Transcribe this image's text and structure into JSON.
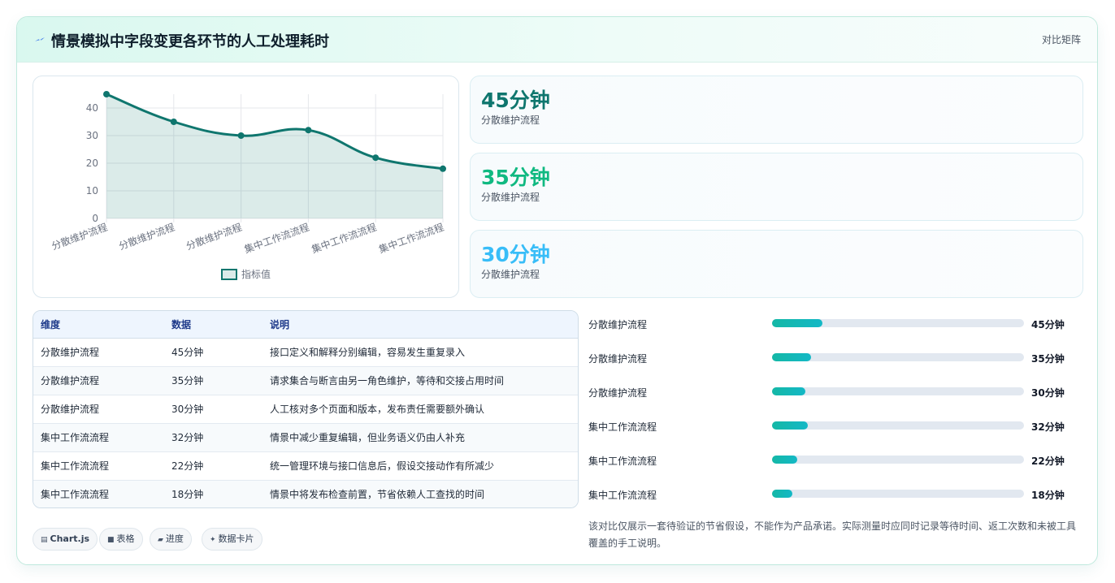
{
  "header": {
    "title": "情景模拟中字段变更各环节的人工处理耗时",
    "compare_label": "对比矩阵"
  },
  "colors": {
    "line": "#0f766e",
    "stat1": "#0f766e",
    "stat2": "#10b981",
    "stat3": "#38bdf8"
  },
  "chart_data": {
    "type": "line",
    "categories": [
      "分散维护流程",
      "分散维护流程",
      "分散维护流程",
      "集中工作流流程",
      "集中工作流流程",
      "集中工作流流程"
    ],
    "series": [
      {
        "name": "指标值",
        "values": [
          45,
          35,
          30,
          32,
          22,
          18
        ]
      }
    ],
    "yticks": [
      "0",
      "10",
      "20",
      "30",
      "40"
    ],
    "ylim": [
      0,
      45
    ],
    "fill": true,
    "grid": true,
    "legend_position": "bottom"
  },
  "stats": [
    {
      "value": "45分钟",
      "label": "分散维护流程"
    },
    {
      "value": "35分钟",
      "label": "分散维护流程"
    },
    {
      "value": "30分钟",
      "label": "分散维护流程"
    }
  ],
  "table": {
    "headers": [
      "维度",
      "数据",
      "说明"
    ],
    "rows": [
      [
        "分散维护流程",
        "45分钟",
        "接口定义和解释分别编辑，容易发生重复录入"
      ],
      [
        "分散维护流程",
        "35分钟",
        "请求集合与断言由另一角色维护，等待和交接占用时间"
      ],
      [
        "分散维护流程",
        "30分钟",
        "人工核对多个页面和版本，发布责任需要额外确认"
      ],
      [
        "集中工作流流程",
        "32分钟",
        "情景中减少重复编辑，但业务语义仍由人补充"
      ],
      [
        "集中工作流流程",
        "22分钟",
        "统一管理环境与接口信息后，假设交接动作有所减少"
      ],
      [
        "集中工作流流程",
        "18分钟",
        "情景中将发布检查前置，节省依赖人工查找的时间"
      ]
    ]
  },
  "progress": [
    {
      "label": "分散维护流程",
      "value": "45分钟",
      "fraction": 0.2
    },
    {
      "label": "分散维护流程",
      "value": "35分钟",
      "fraction": 0.155
    },
    {
      "label": "分散维护流程",
      "value": "30分钟",
      "fraction": 0.133
    },
    {
      "label": "集中工作流流程",
      "value": "32分钟",
      "fraction": 0.143
    },
    {
      "label": "集中工作流流程",
      "value": "22分钟",
      "fraction": 0.1
    },
    {
      "label": "集中工作流流程",
      "value": "18分钟",
      "fraction": 0.08
    }
  ],
  "chips": [
    {
      "icon": "▤",
      "label": "Chart.js"
    },
    {
      "icon": "■",
      "label": "表格"
    },
    {
      "icon": "▰",
      "label": "进度"
    },
    {
      "icon": "✦",
      "label": "数据卡片"
    }
  ],
  "note": "该对比仅展示一套待验证的节省假设，不能作为产品承诺。实际测量时应同时记录等待时间、返工次数和未被工具覆盖的手工说明。"
}
